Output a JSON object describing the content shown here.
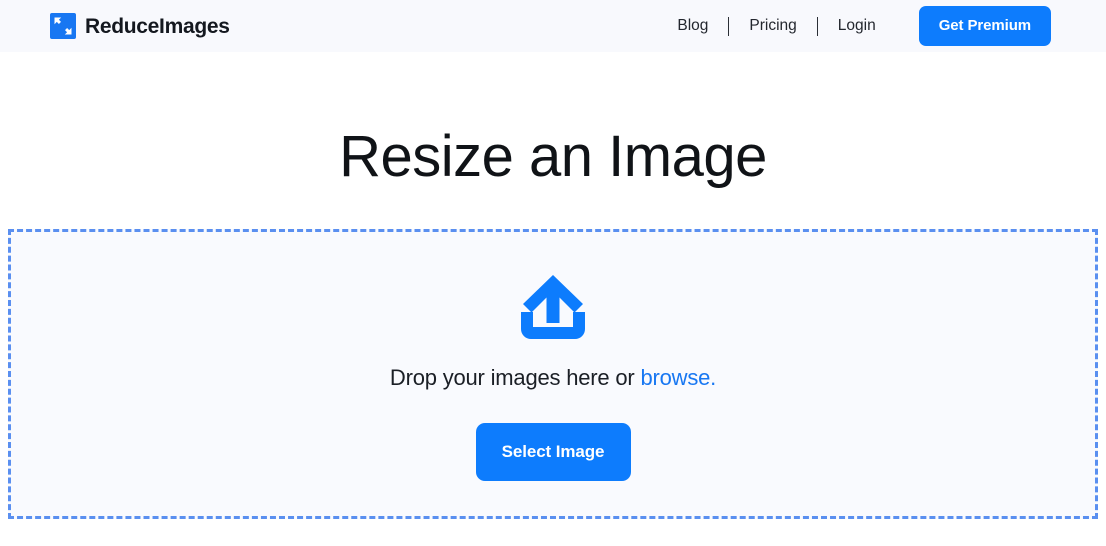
{
  "header": {
    "brand": {
      "name": "ReduceImages",
      "logo_icon": "reduce-arrows-logo-icon",
      "logo_color": "#1877f2"
    },
    "nav": [
      {
        "label": "Blog"
      },
      {
        "label": "Pricing"
      },
      {
        "label": "Login"
      }
    ],
    "cta": {
      "label": "Get Premium",
      "color": "#0d7cfd"
    },
    "background": "#f8f9fd"
  },
  "main": {
    "title": "Resize an Image",
    "dropzone": {
      "upload_icon": "upload-arrow-icon",
      "icon_color": "#0d7cfd",
      "drop_text_prefix": "Drop your images here or ",
      "browse_label": "browse.",
      "browse_color": "#1877f2",
      "select_button_label": "Select Image",
      "button_color": "#0d7cfd",
      "border_color": "#5a8ff0",
      "background": "#f9fafe"
    }
  }
}
